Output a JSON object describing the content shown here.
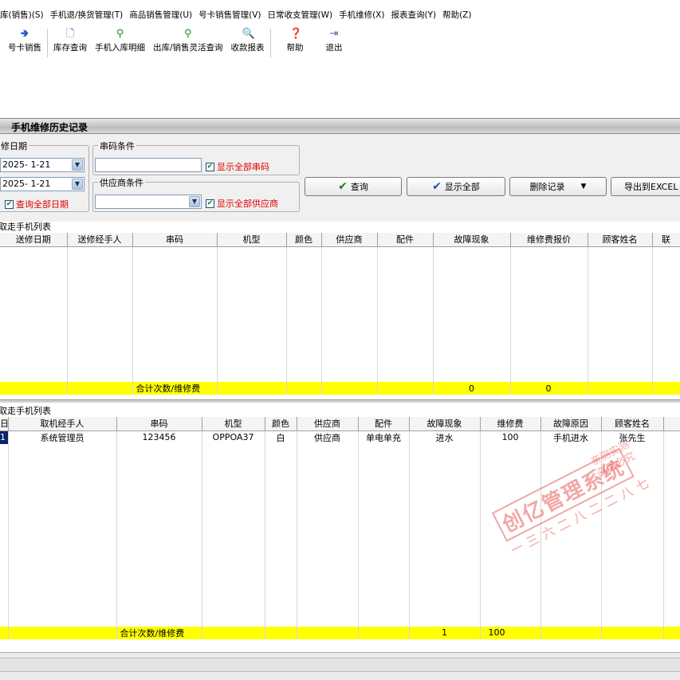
{
  "menu": [
    "库(销售)(S)",
    "手机退/换货管理(T)",
    "商品销售管理(U)",
    "号卡销售管理(V)",
    "日常收支管理(W)",
    "手机维修(X)",
    "报表查询(Y)",
    "帮助(Z)"
  ],
  "toolbar": [
    {
      "label": "号卡销售",
      "icon": "card-icon"
    },
    {
      "label": "库存查询",
      "icon": "document-search-icon"
    },
    {
      "label": "手机入库明细",
      "icon": "magnifier-icon"
    },
    {
      "label": "出库/销售灵活查询",
      "icon": "magnifier-icon"
    },
    {
      "label": "收款报表",
      "icon": "report-icon"
    },
    {
      "label": "帮助",
      "icon": "help-icon"
    },
    {
      "label": "退出",
      "icon": "exit-icon"
    }
  ],
  "window_title": "手机维修历史记录",
  "filters": {
    "date_group": "修日期",
    "date_from": "2025- 1-21",
    "date_to": "2025- 1-21",
    "query_all_dates": "查询全部日期",
    "serial_group": "串码条件",
    "serial_value": "",
    "show_all_serials": "显示全部串码",
    "supplier_group": "供应商条件",
    "supplier_value": "",
    "show_all_suppliers": "显示全部供应商"
  },
  "buttons": {
    "query": "查询",
    "show_all": "显示全部",
    "delete": "删除记录",
    "export": "导出到EXCEL"
  },
  "not_picked": {
    "label": "取走手机列表",
    "columns": [
      "送修日期",
      "送修经手人",
      "串码",
      "机型",
      "颜色",
      "供应商",
      "配件",
      "故障现象",
      "维修费报价",
      "顾客姓名",
      "联"
    ],
    "rows": [],
    "summary": {
      "label": "合计次数/维修费",
      "count": "0",
      "fee": "0"
    }
  },
  "picked": {
    "label": "取走手机列表",
    "columns": [
      "日",
      "取机经手人",
      "串码",
      "机型",
      "颜色",
      "供应商",
      "配件",
      "故障现象",
      "维修费",
      "故障原因",
      "顾客姓名",
      ""
    ],
    "rows": [
      [
        "1",
        "系统管理员",
        "123456",
        "OPPOA37",
        "白",
        "供应商",
        "单电单充",
        "进水",
        "100",
        "手机进水",
        "张先生",
        ""
      ]
    ],
    "summary": {
      "label": "合计次数/维修费",
      "count": "1",
      "fee": "100"
    }
  },
  "watermark": {
    "main": "创亿管理系统",
    "sub": "一三六二八二二八七",
    "side": "亲测实测 盗用必究"
  },
  "colors": {
    "summary_row": "#ffff00",
    "checkbox_text": "#e00000",
    "check_green": "#1a7a1a",
    "watermark": "#e13c3c"
  }
}
